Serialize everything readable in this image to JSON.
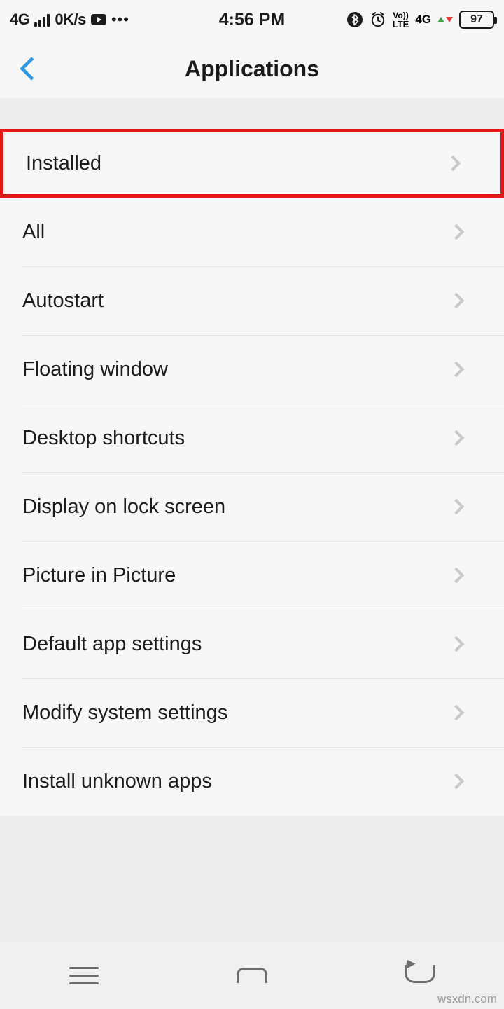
{
  "status_bar": {
    "network_type": "4G",
    "signal_icon": "signal-bars-icon",
    "data_speed": "0K/s",
    "youtube_icon": "youtube-icon",
    "more_icon": "ellipsis-icon",
    "clock": "4:56 PM",
    "bluetooth_icon": "bluetooth-icon",
    "alarm_icon": "alarm-clock-icon",
    "volte_top": "Vo))",
    "volte_bottom": "LTE",
    "sim2_network": "4G",
    "data_arrows_icon": "data-transfer-icon",
    "battery_level": "97"
  },
  "title_bar": {
    "back_icon": "back-chevron-icon",
    "title": "Applications"
  },
  "list": {
    "items": [
      {
        "label": "Installed",
        "chevron": "chevron-right-icon",
        "highlighted": true
      },
      {
        "label": "All",
        "chevron": "chevron-right-icon",
        "highlighted": false
      },
      {
        "label": "Autostart",
        "chevron": "chevron-right-icon",
        "highlighted": false
      },
      {
        "label": "Floating window",
        "chevron": "chevron-right-icon",
        "highlighted": false
      },
      {
        "label": "Desktop shortcuts",
        "chevron": "chevron-right-icon",
        "highlighted": false
      },
      {
        "label": "Display on lock screen",
        "chevron": "chevron-right-icon",
        "highlighted": false
      },
      {
        "label": "Picture in Picture",
        "chevron": "chevron-right-icon",
        "highlighted": false
      },
      {
        "label": "Default app settings",
        "chevron": "chevron-right-icon",
        "highlighted": false
      },
      {
        "label": "Modify system settings",
        "chevron": "chevron-right-icon",
        "highlighted": false
      },
      {
        "label": "Install unknown apps",
        "chevron": "chevron-right-icon",
        "highlighted": false
      }
    ]
  },
  "nav_bar": {
    "menu_icon": "menu-icon",
    "home_icon": "home-icon",
    "back_icon": "back-arrow-icon"
  },
  "watermark": "wsxdn.com",
  "colors": {
    "highlight": "#e01a1a",
    "accent": "#3296e1",
    "background": "#f7f7f7",
    "divider_background": "#ececec"
  }
}
